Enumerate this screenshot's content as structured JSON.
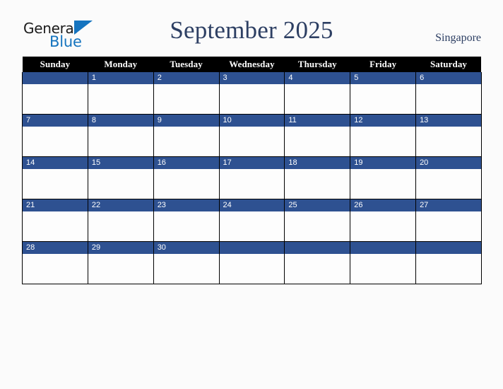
{
  "brand": {
    "logo_line1": "General",
    "logo_line2": "Blue",
    "logo_icon": "triangle-icon",
    "color_black": "#1b1b1b",
    "color_blue": "#1574bf"
  },
  "header": {
    "title": "September 2025",
    "country": "Singapore",
    "title_color": "#2d3f63"
  },
  "calendar": {
    "month": "September",
    "year": "2025",
    "accent_header_bg": "#000000",
    "accent_daystrip_bg": "#2e5191",
    "grid_line_color": "#000000",
    "cell_bg": "#fdfdfd",
    "weekday_headers": [
      "Sunday",
      "Monday",
      "Tuesday",
      "Wednesday",
      "Thursday",
      "Friday",
      "Saturday"
    ],
    "weeks": [
      [
        "",
        "1",
        "2",
        "3",
        "4",
        "5",
        "6"
      ],
      [
        "7",
        "8",
        "9",
        "10",
        "11",
        "12",
        "13"
      ],
      [
        "14",
        "15",
        "16",
        "17",
        "18",
        "19",
        "20"
      ],
      [
        "21",
        "22",
        "23",
        "24",
        "25",
        "26",
        "27"
      ],
      [
        "28",
        "29",
        "30",
        "",
        "",
        "",
        ""
      ]
    ]
  }
}
